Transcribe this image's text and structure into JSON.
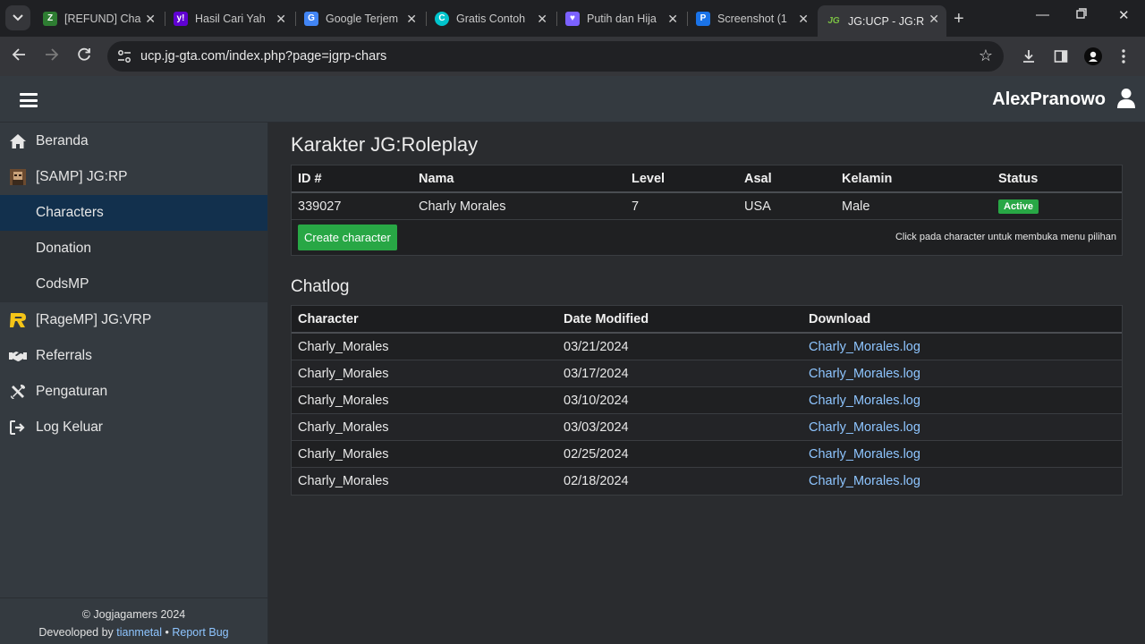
{
  "browser": {
    "tabs": [
      {
        "title": "[REFUND] Cha",
        "favicon": "green-jg"
      },
      {
        "title": "Hasil Cari Yah",
        "favicon": "yahoo"
      },
      {
        "title": "Google Terjem",
        "favicon": "translate"
      },
      {
        "title": "Gratis Contoh",
        "favicon": "canva"
      },
      {
        "title": "Putih dan Hija",
        "favicon": "heart"
      },
      {
        "title": "Screenshot (1",
        "favicon": "p-blue"
      },
      {
        "title": "JG:UCP - JG:R",
        "favicon": "jg-active"
      }
    ],
    "url": "ucp.jg-gta.com/index.php?page=jgrp-chars"
  },
  "header": {
    "username": "AlexPranowo"
  },
  "sidebar": {
    "items": [
      {
        "label": "Beranda",
        "icon": "home-icon"
      },
      {
        "label": "[SAMP] JG:RP",
        "icon": "samp-avatar-icon"
      },
      {
        "label": "Characters"
      },
      {
        "label": "Donation"
      },
      {
        "label": "CodsMP"
      },
      {
        "label": "[RageMP] JG:VRP",
        "icon": "ragemp-icon"
      },
      {
        "label": "Referrals",
        "icon": "handshake-icon"
      },
      {
        "label": "Pengaturan",
        "icon": "tools-icon"
      },
      {
        "label": "Log Keluar",
        "icon": "logout-icon"
      }
    ],
    "footer": {
      "copyright": "© Jogjagamers 2024",
      "developed_prefix": "Deveoloped by",
      "developer": "tianmetal",
      "separator": "•",
      "report": "Report Bug"
    }
  },
  "characters": {
    "title": "Karakter JG:Roleplay",
    "columns": [
      "ID #",
      "Nama",
      "Level",
      "Asal",
      "Kelamin",
      "Status"
    ],
    "rows": [
      {
        "id": "339027",
        "nama": "Charly Morales",
        "level": "7",
        "asal": "USA",
        "kelamin": "Male",
        "status": "Active"
      }
    ],
    "create_label": "Create character",
    "hint": "Click pada character untuk membuka menu pilihan"
  },
  "chatlog": {
    "title": "Chatlog",
    "columns": [
      "Character",
      "Date Modified",
      "Download"
    ],
    "rows": [
      {
        "character": "Charly_Morales",
        "date": "03/21/2024",
        "file": "Charly_Morales.log"
      },
      {
        "character": "Charly_Morales",
        "date": "03/17/2024",
        "file": "Charly_Morales.log"
      },
      {
        "character": "Charly_Morales",
        "date": "03/10/2024",
        "file": "Charly_Morales.log"
      },
      {
        "character": "Charly_Morales",
        "date": "03/03/2024",
        "file": "Charly_Morales.log"
      },
      {
        "character": "Charly_Morales",
        "date": "02/25/2024",
        "file": "Charly_Morales.log"
      },
      {
        "character": "Charly_Morales",
        "date": "02/18/2024",
        "file": "Charly_Morales.log"
      }
    ]
  },
  "colors": {
    "accent_green": "#28a745",
    "sidebar_active": "#12304d",
    "link": "#8ec5ff"
  }
}
